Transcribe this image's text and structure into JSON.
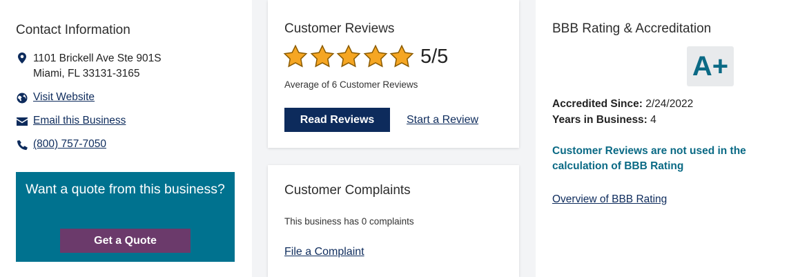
{
  "contact": {
    "title": "Contact Information",
    "address_line1": "1101 Brickell Ave Ste 901S",
    "address_line2": "Miami, FL 33131-3165",
    "website_label": "Visit Website",
    "email_label": "Email this Business",
    "phone": "(800) 757-7050",
    "icons": [
      "location-pin-icon",
      "globe-icon",
      "envelope-icon",
      "phone-icon"
    ]
  },
  "quote": {
    "text": "Want a quote from this business?",
    "button_label": "Get a Quote",
    "box_color": "#00728f",
    "button_color": "#6b3a6b"
  },
  "reviews": {
    "title": "Customer Reviews",
    "rating": "5/5",
    "stars_filled": 5,
    "stars_total": 5,
    "average_text": "Average of 6 Customer Reviews",
    "read_button": "Read Reviews",
    "start_link": "Start a Review",
    "star_color": "#f5a623"
  },
  "complaints": {
    "title": "Customer Complaints",
    "count_text": "This business has 0 complaints",
    "file_link": "File a Complaint"
  },
  "bbb": {
    "title": "BBB Rating & Accreditation",
    "grade": "A+",
    "accredited_label": "Accredited Since:",
    "accredited_value": "2/24/2022",
    "years_label": "Years in Business:",
    "years_value": "4",
    "note": "Customer Reviews are not used in the calculation of BBB Rating",
    "overview_link": "Overview of BBB Rating",
    "accent_color": "#0b6a85"
  }
}
